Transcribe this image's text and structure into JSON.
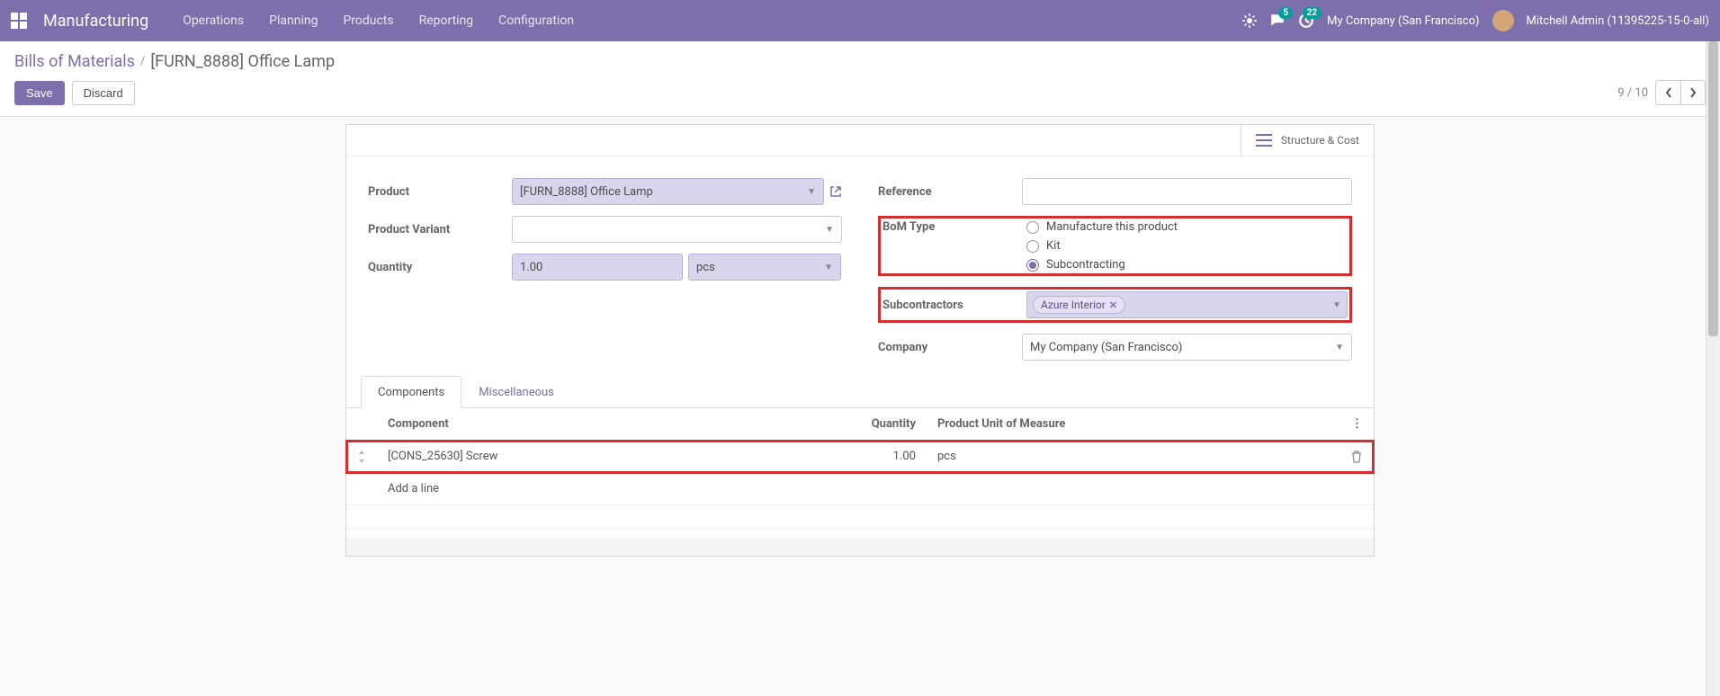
{
  "navbar": {
    "app_name": "Manufacturing",
    "menu": [
      "Operations",
      "Planning",
      "Products",
      "Reporting",
      "Configuration"
    ],
    "msg_badge": "5",
    "activity_badge": "22",
    "company": "My Company (San Francisco)",
    "user": "Mitchell Admin (11395225-15-0-all)"
  },
  "breadcrumb": {
    "root": "Bills of Materials",
    "current": "[FURN_8888] Office Lamp"
  },
  "actions": {
    "save": "Save",
    "discard": "Discard"
  },
  "pager": {
    "text": "9 / 10"
  },
  "stat": {
    "label": "Structure & Cost"
  },
  "form": {
    "product_label": "Product",
    "product_value": "[FURN_8888] Office Lamp",
    "variant_label": "Product Variant",
    "quantity_label": "Quantity",
    "quantity_value": "1.00",
    "quantity_unit": "pcs",
    "reference_label": "Reference",
    "bom_type_label": "BoM Type",
    "bom_opt1": "Manufacture this product",
    "bom_opt2": "Kit",
    "bom_opt3": "Subcontracting",
    "subcontractors_label": "Subcontractors",
    "subcontractor_tag": "Azure Interior",
    "company_label": "Company",
    "company_value": "My Company (San Francisco)"
  },
  "tabs": {
    "t1": "Components",
    "t2": "Miscellaneous"
  },
  "table": {
    "h1": "Component",
    "h2": "Quantity",
    "h3": "Product Unit of Measure",
    "row1_component": "[CONS_25630] Screw",
    "row1_qty": "1.00",
    "row1_uom": "pcs",
    "add_line": "Add a line"
  }
}
